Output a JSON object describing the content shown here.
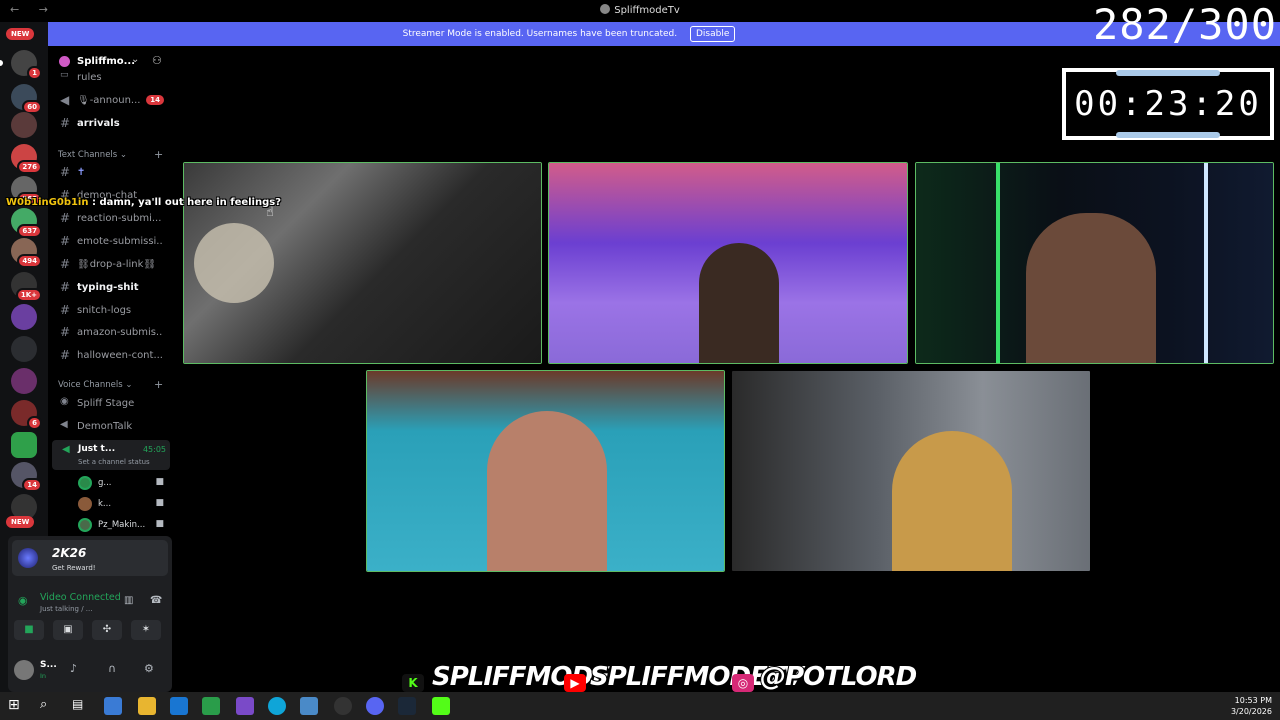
{
  "window": {
    "title": "SpliffmodeTv",
    "nav": "← →"
  },
  "banner": {
    "text": "Streamer Mode is enabled. Usernames have been truncated.",
    "disable_label": "Disable"
  },
  "rail": {
    "new_top": "NEW",
    "new_bottom": "NEW",
    "badges": [
      "1",
      "60",
      "276",
      "568",
      "637",
      "494",
      "1K+",
      "6",
      "14"
    ]
  },
  "server": {
    "name": "Spliffmo..."
  },
  "channels_top": [
    {
      "name": "rules"
    },
    {
      "name": "🎙-announ...",
      "badge": "14"
    },
    {
      "name": "arrivals"
    }
  ],
  "text_category": "Text Channels",
  "text_channels": [
    {
      "name": "✝"
    },
    {
      "name": "demon-chat"
    },
    {
      "name": "reaction-submi..."
    },
    {
      "name": "emote-submissi..."
    },
    {
      "name": "⛓drop-a-link⛓"
    },
    {
      "name": "typing-shit"
    },
    {
      "name": "snitch-logs"
    },
    {
      "name": "amazon-submis..."
    },
    {
      "name": "halloween-cont..."
    }
  ],
  "voice_category": "Voice Channels",
  "voice_channels": [
    {
      "name": "Spliff Stage"
    },
    {
      "name": "DemonTalk"
    }
  ],
  "active_voice": {
    "name": "Just t...",
    "time": "45:05",
    "status": "Set a channel status"
  },
  "voice_members": [
    {
      "name": "g..."
    },
    {
      "name": "k..."
    },
    {
      "name": "Pz_Makin..."
    }
  ],
  "reward": {
    "game": "2K26",
    "cta": "Get Reward!"
  },
  "voice_connection": {
    "title": "Video Connected",
    "subtitle": "Just talking / ..."
  },
  "user": {
    "name": "S...",
    "status": "In"
  },
  "overlay": {
    "counter": "282/300",
    "timer": "00:23:20",
    "chat_user": "W0b1inG0b1in",
    "chat_text": ": damn, ya'll out here in feelings?"
  },
  "socials": [
    {
      "icon": "kick-icon",
      "handle": "SPLIFFMODE",
      "color": "#53fc18"
    },
    {
      "icon": "youtube-icon",
      "handle": "SPLIFFMODETV",
      "color": "#ff0000"
    },
    {
      "icon": "instagram-icon",
      "handle": "@POTLORD",
      "color": "#d62976"
    }
  ],
  "taskbar": {
    "time": "10:53 PM",
    "date": "3/20/2026"
  },
  "colors": {
    "accent": "#5865f2",
    "tile_border": "#5dbb63",
    "danger": "#da373c",
    "online": "#23a55a"
  }
}
